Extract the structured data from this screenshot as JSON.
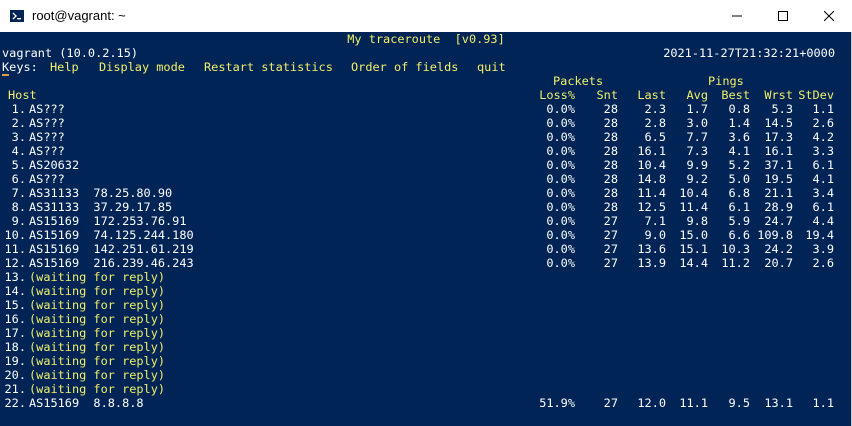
{
  "window": {
    "title": "root@vagrant: ~",
    "minimize_icon": "minimize-icon",
    "maximize_icon": "maximize-icon",
    "close_icon": "close-icon"
  },
  "mtr": {
    "header_title": "My traceroute  [v0.93]",
    "host_info": "vagrant (10.0.2.15)",
    "timestamp": "2021-11-27T21:32:21+0000",
    "keys_label": "Keys:",
    "keys": [
      "Help",
      "Display mode",
      "Restart statistics",
      "Order of fields",
      "quit"
    ],
    "group_packets": "Packets",
    "group_pings": "Pings",
    "columns": {
      "host": "Host",
      "loss": "Loss%",
      "snt": "Snt",
      "last": "Last",
      "avg": "Avg",
      "best": "Best",
      "wrst": "Wrst",
      "stdev": "StDev"
    },
    "rows": [
      {
        "num": "1.",
        "host": "AS???",
        "loss": "0.0%",
        "snt": "28",
        "last": "2.3",
        "avg": "1.7",
        "best": "0.8",
        "wrst": "5.3",
        "stdev": "1.1"
      },
      {
        "num": "2.",
        "host": "AS???",
        "loss": "0.0%",
        "snt": "28",
        "last": "2.8",
        "avg": "3.0",
        "best": "1.4",
        "wrst": "14.5",
        "stdev": "2.6"
      },
      {
        "num": "3.",
        "host": "AS???",
        "loss": "0.0%",
        "snt": "28",
        "last": "6.5",
        "avg": "7.7",
        "best": "3.6",
        "wrst": "17.3",
        "stdev": "4.2"
      },
      {
        "num": "4.",
        "host": "AS???",
        "loss": "0.0%",
        "snt": "28",
        "last": "16.1",
        "avg": "7.3",
        "best": "4.1",
        "wrst": "16.1",
        "stdev": "3.3"
      },
      {
        "num": "5.",
        "host": "AS20632",
        "loss": "0.0%",
        "snt": "28",
        "last": "10.4",
        "avg": "9.9",
        "best": "5.2",
        "wrst": "37.1",
        "stdev": "6.1"
      },
      {
        "num": "6.",
        "host": "AS???",
        "loss": "0.0%",
        "snt": "28",
        "last": "14.8",
        "avg": "9.2",
        "best": "5.0",
        "wrst": "19.5",
        "stdev": "4.1"
      },
      {
        "num": "7.",
        "host": "AS31133  78.25.80.90",
        "loss": "0.0%",
        "snt": "28",
        "last": "11.4",
        "avg": "10.4",
        "best": "6.8",
        "wrst": "21.1",
        "stdev": "3.4"
      },
      {
        "num": "8.",
        "host": "AS31133  37.29.17.85",
        "loss": "0.0%",
        "snt": "28",
        "last": "12.5",
        "avg": "11.4",
        "best": "6.1",
        "wrst": "28.9",
        "stdev": "6.1"
      },
      {
        "num": "9.",
        "host": "AS15169  172.253.76.91",
        "loss": "0.0%",
        "snt": "27",
        "last": "7.1",
        "avg": "9.8",
        "best": "5.9",
        "wrst": "24.7",
        "stdev": "4.4"
      },
      {
        "num": "10.",
        "host": "AS15169  74.125.244.180",
        "loss": "0.0%",
        "snt": "27",
        "last": "9.0",
        "avg": "15.0",
        "best": "6.6",
        "wrst": "109.8",
        "stdev": "19.4"
      },
      {
        "num": "11.",
        "host": "AS15169  142.251.61.219",
        "loss": "0.0%",
        "snt": "27",
        "last": "13.6",
        "avg": "15.1",
        "best": "10.3",
        "wrst": "24.2",
        "stdev": "3.9"
      },
      {
        "num": "12.",
        "host": "AS15169  216.239.46.243",
        "loss": "0.0%",
        "snt": "27",
        "last": "13.9",
        "avg": "14.4",
        "best": "11.2",
        "wrst": "20.7",
        "stdev": "2.6"
      }
    ],
    "waiting_rows": [
      {
        "num": "13.",
        "text": "(waiting for reply)"
      },
      {
        "num": "14.",
        "text": "(waiting for reply)"
      },
      {
        "num": "15.",
        "text": "(waiting for reply)"
      },
      {
        "num": "16.",
        "text": "(waiting for reply)"
      },
      {
        "num": "17.",
        "text": "(waiting for reply)"
      },
      {
        "num": "18.",
        "text": "(waiting for reply)"
      },
      {
        "num": "19.",
        "text": "(waiting for reply)"
      },
      {
        "num": "20.",
        "text": "(waiting for reply)"
      },
      {
        "num": "21.",
        "text": "(waiting for reply)"
      }
    ],
    "final_row": {
      "num": "22.",
      "host": "AS15169  8.8.8.8",
      "loss": "51.9%",
      "snt": "27",
      "last": "12.0",
      "avg": "11.1",
      "best": "9.5",
      "wrst": "13.1",
      "stdev": "1.1"
    }
  },
  "colors": {
    "terminal_bg": "#012456",
    "text": "#ffffff",
    "header": "#f1ef6a"
  }
}
